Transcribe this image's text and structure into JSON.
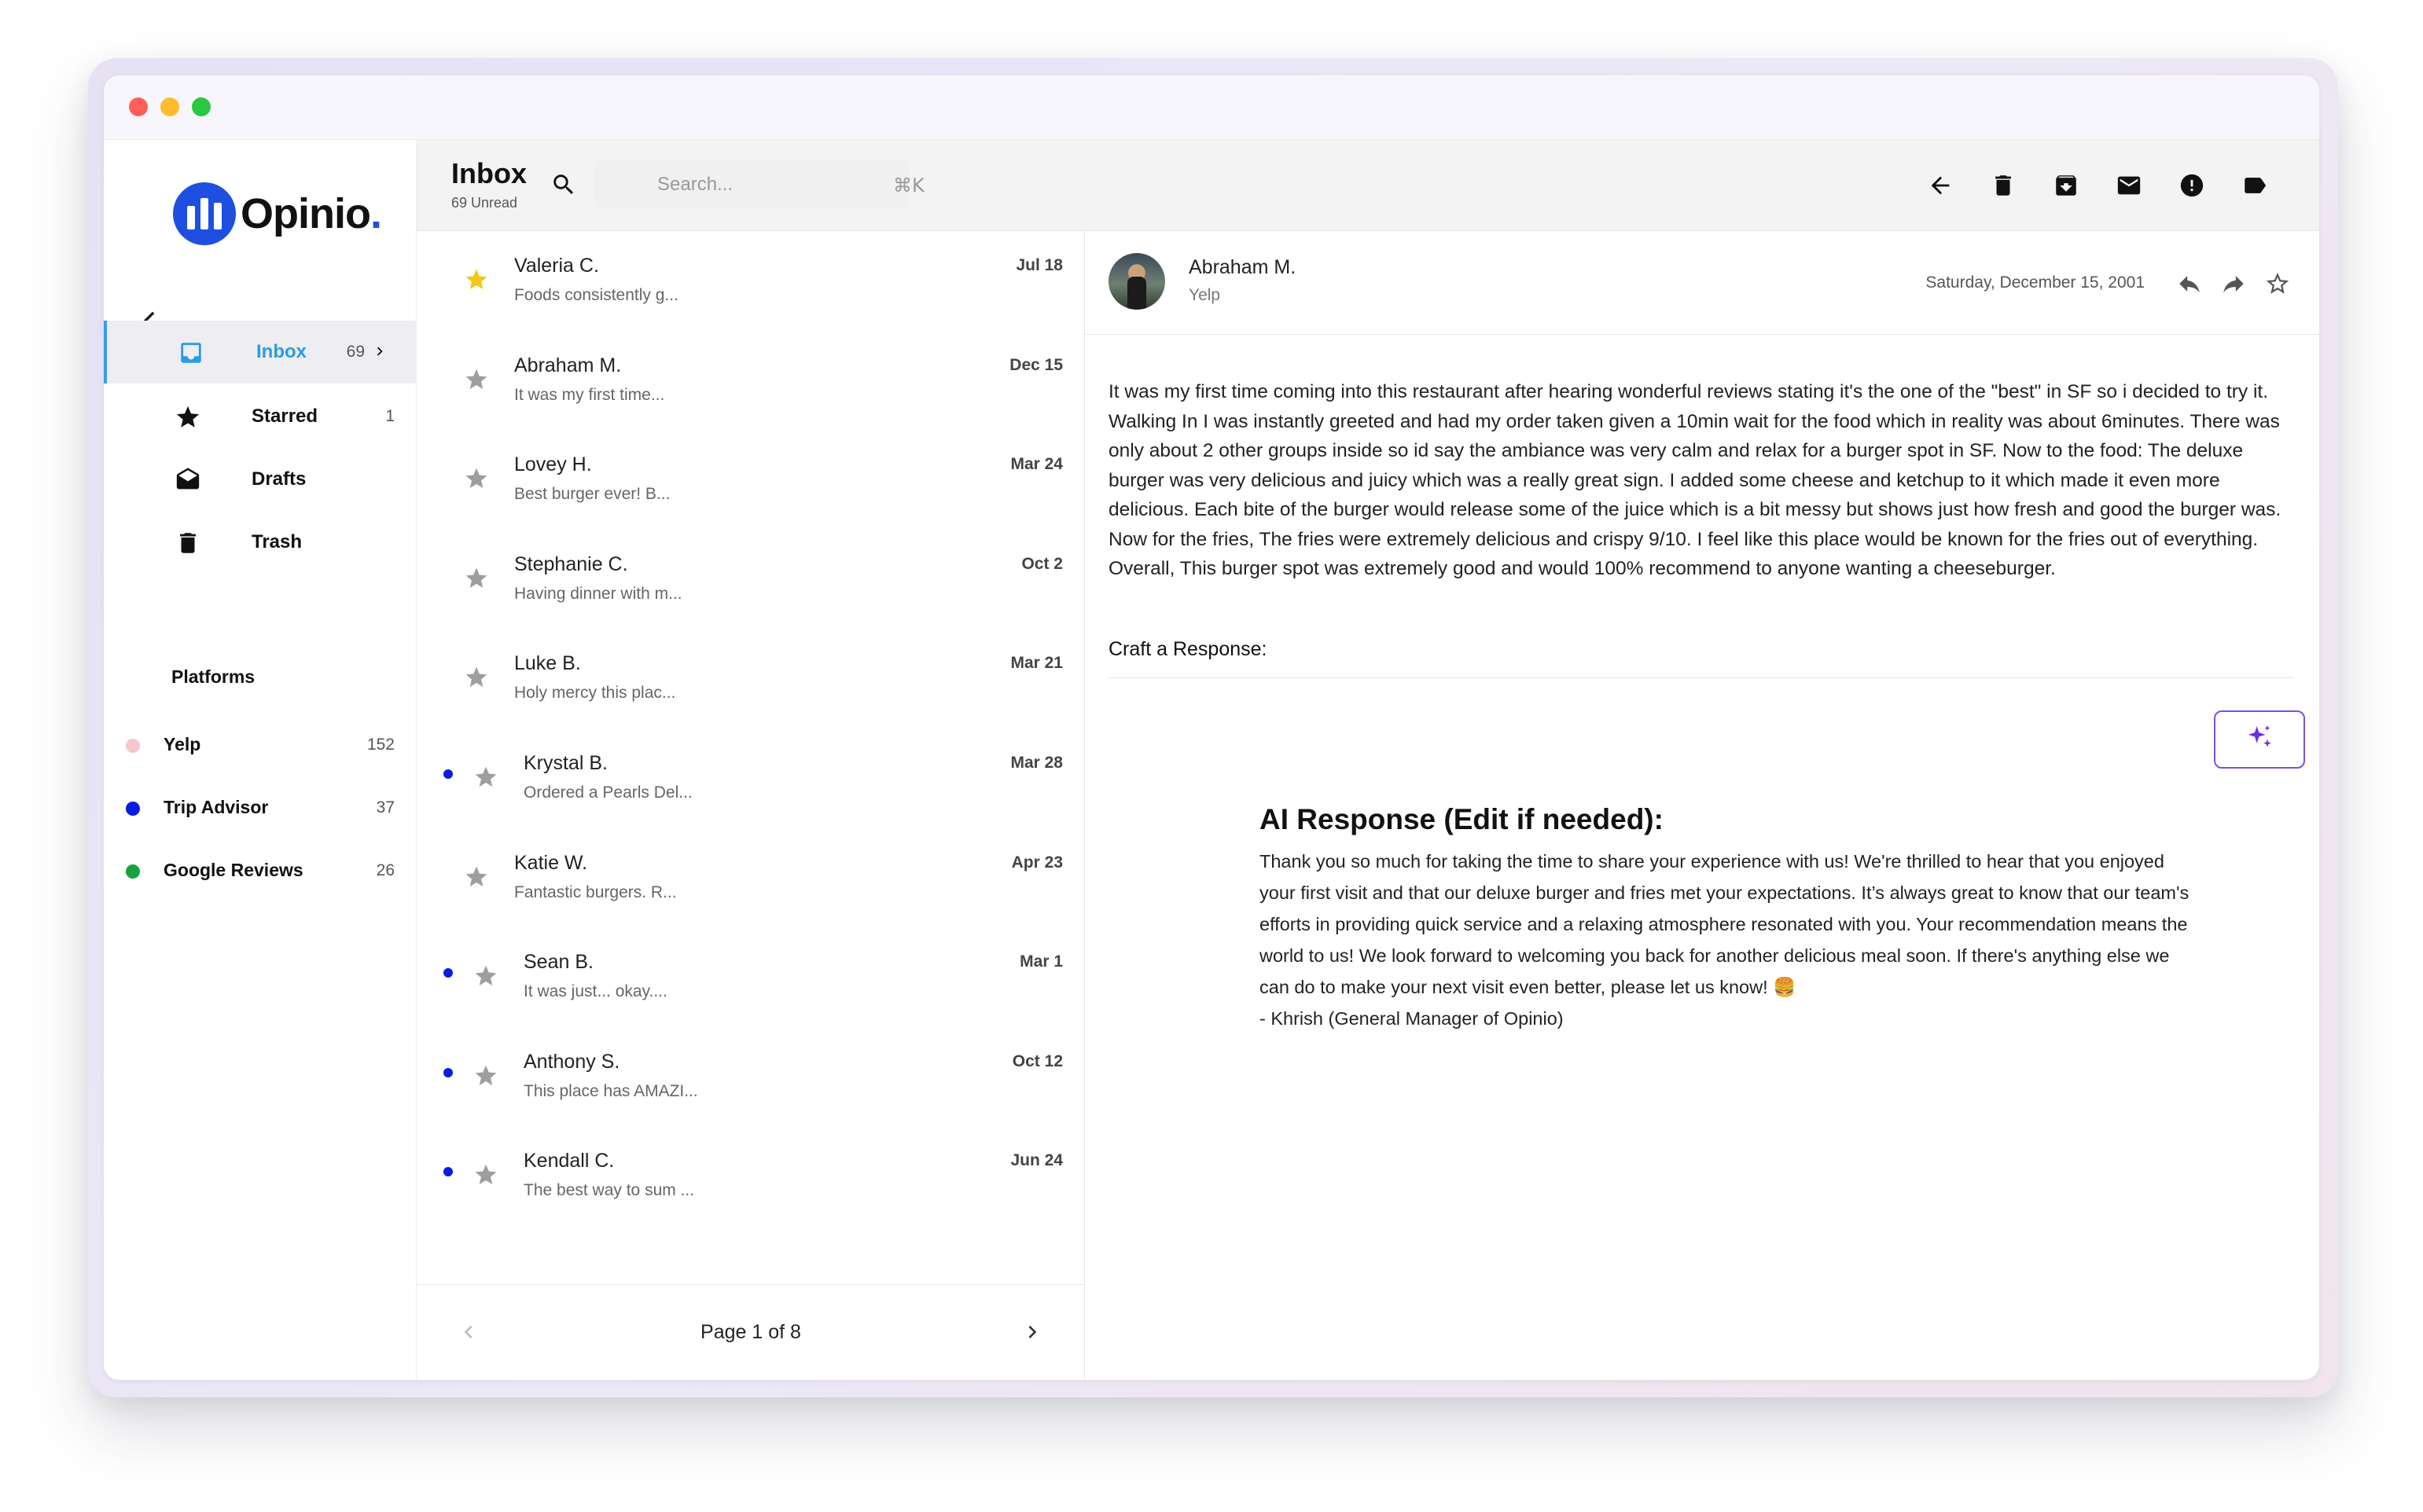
{
  "window": {
    "colors": {
      "accent": "#2a9be6",
      "brand": "#1e4fe0",
      "ai_border": "#7b4fe0",
      "unread_dot": "#0a1ce0",
      "star_active": "#f5c518",
      "star_inactive": "#9e9e9e"
    }
  },
  "sidebar": {
    "logo_text": "Opinio",
    "logo_dot": ".",
    "nav": [
      {
        "label": "Inbox",
        "count": "69",
        "icon": "inbox-icon"
      },
      {
        "label": "Starred",
        "count": "1",
        "icon": "star-icon"
      },
      {
        "label": "Drafts",
        "count": "",
        "icon": "envelope-open-icon"
      },
      {
        "label": "Trash",
        "count": "",
        "icon": "trash-icon"
      }
    ],
    "platforms_title": "Platforms",
    "platforms": [
      {
        "label": "Yelp",
        "count": "152",
        "color": "#f7c6cf"
      },
      {
        "label": "Trip Advisor",
        "count": "37",
        "color": "#0a1ce0"
      },
      {
        "label": "Google Reviews",
        "count": "26",
        "color": "#17a33a"
      }
    ]
  },
  "header": {
    "title": "Inbox",
    "subtitle": "69 Unread",
    "search_placeholder": "Search...",
    "search_shortcut": "⌘K"
  },
  "emails": [
    {
      "sender": "Valeria C.",
      "preview": "Foods consistently g...",
      "date": "Jul 18",
      "starred": true,
      "unread": false
    },
    {
      "sender": "Abraham M.",
      "preview": "It was my first time...",
      "date": "Dec 15",
      "starred": false,
      "unread": false
    },
    {
      "sender": "Lovey H.",
      "preview": "Best burger ever! B...",
      "date": "Mar 24",
      "starred": false,
      "unread": false
    },
    {
      "sender": "Stephanie C.",
      "preview": "Having dinner with m...",
      "date": "Oct 2",
      "starred": false,
      "unread": false
    },
    {
      "sender": "Luke B.",
      "preview": "Holy mercy this plac...",
      "date": "Mar 21",
      "starred": false,
      "unread": false
    },
    {
      "sender": "Krystal B.",
      "preview": "Ordered a Pearls Del...",
      "date": "Mar 28",
      "starred": false,
      "unread": true
    },
    {
      "sender": "Katie W.",
      "preview": "Fantastic burgers. R...",
      "date": "Apr 23",
      "starred": false,
      "unread": false
    },
    {
      "sender": "Sean B.",
      "preview": "It was just... okay....",
      "date": "Mar 1",
      "starred": false,
      "unread": true
    },
    {
      "sender": "Anthony S.",
      "preview": "This place has AMAZI...",
      "date": "Oct 12",
      "starred": false,
      "unread": true
    },
    {
      "sender": "Kendall C.",
      "preview": "The best way to sum ...",
      "date": "Jun 24",
      "starred": false,
      "unread": true
    }
  ],
  "pager": {
    "text": "Page 1 of 8"
  },
  "reader": {
    "sender": "Abraham M.",
    "platform": "Yelp",
    "date": "Saturday, December 15, 2001",
    "body": "It was my first time coming into this restaurant after hearing wonderful reviews stating it's the one of the \"best\" in SF so i decided to try it. Walking In I was instantly greeted and had my order taken given a 10min wait for the food which in reality was about 6minutes. There was only about 2 other groups inside so id say the ambiance was very calm and relax for a burger spot in SF. Now to the food: The deluxe burger was very delicious and juicy which was a really great sign. I added some cheese and ketchup to it which made it even more delicious. Each bite of the burger would release some of the juice which is a bit messy but shows just how fresh and good the burger was. Now for the fries, The fries were extremely delicious and crispy 9/10. I feel like this place would be known for the fries out of everything. Overall, This burger spot was extremely good and would 100% recommend to anyone wanting a cheeseburger.",
    "craft_label": "Craft a Response:",
    "ai_title": "AI Response (Edit if needed):",
    "ai_body": "Thank you so much for taking the time to share your experience with us! We're thrilled to hear that you enjoyed your first visit and that our deluxe burger and fries met your expectations. It’s always great to know that our team's efforts in providing quick service and a relaxing atmosphere resonated with you. Your recommendation means the world to us! We look forward to welcoming you back for another delicious meal soon. If there's anything else we can do to make your next visit even better, please let us know! 🍔",
    "ai_signature": "- Khrish (General Manager of Opinio)"
  }
}
